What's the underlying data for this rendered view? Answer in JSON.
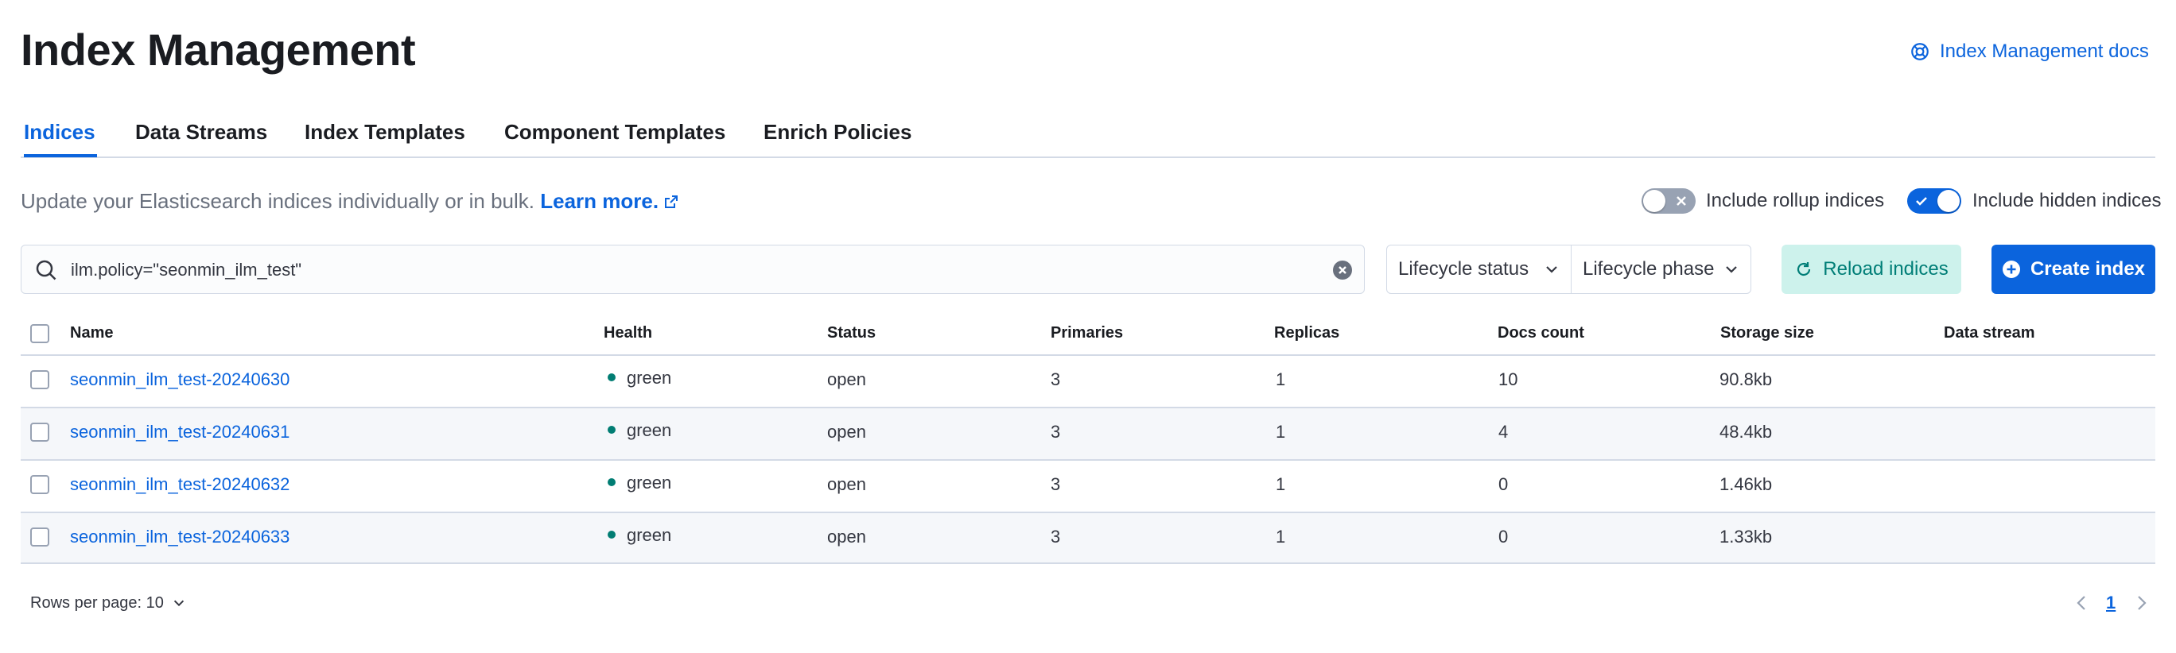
{
  "header": {
    "title": "Index Management",
    "docs_link": "Index Management docs"
  },
  "tabs": [
    {
      "label": "Indices",
      "active": true
    },
    {
      "label": "Data Streams",
      "active": false
    },
    {
      "label": "Index Templates",
      "active": false
    },
    {
      "label": "Component Templates",
      "active": false
    },
    {
      "label": "Enrich Policies",
      "active": false
    }
  ],
  "description": {
    "text": "Update your Elasticsearch indices individually or in bulk.",
    "learn_more": "Learn more."
  },
  "toggles": {
    "rollup": {
      "label": "Include rollup indices",
      "checked": false
    },
    "hidden": {
      "label": "Include hidden indices",
      "checked": true
    }
  },
  "search": {
    "value": "ilm.policy=\"seonmin_ilm_test\""
  },
  "filters": {
    "lifecycle_status": "Lifecycle status",
    "lifecycle_phase": "Lifecycle phase"
  },
  "buttons": {
    "reload": "Reload indices",
    "create": "Create index"
  },
  "table": {
    "columns": [
      "Name",
      "Health",
      "Status",
      "Primaries",
      "Replicas",
      "Docs count",
      "Storage size",
      "Data stream"
    ],
    "rows": [
      {
        "name": "seonmin_ilm_test-20240630",
        "health": "green",
        "status": "open",
        "primaries": "3",
        "replicas": "1",
        "docs_count": "10",
        "storage_size": "90.8kb",
        "data_stream": ""
      },
      {
        "name": "seonmin_ilm_test-20240631",
        "health": "green",
        "status": "open",
        "primaries": "3",
        "replicas": "1",
        "docs_count": "4",
        "storage_size": "48.4kb",
        "data_stream": ""
      },
      {
        "name": "seonmin_ilm_test-20240632",
        "health": "green",
        "status": "open",
        "primaries": "3",
        "replicas": "1",
        "docs_count": "0",
        "storage_size": "1.46kb",
        "data_stream": ""
      },
      {
        "name": "seonmin_ilm_test-20240633",
        "health": "green",
        "status": "open",
        "primaries": "3",
        "replicas": "1",
        "docs_count": "0",
        "storage_size": "1.33kb",
        "data_stream": ""
      }
    ]
  },
  "pagination": {
    "rows_per_page": "Rows per page: 10",
    "current_page": "1"
  },
  "colors": {
    "primary": "#0b64dd",
    "health_green": "#017d73",
    "reload_bg": "#cdf2ec",
    "reload_text": "#007e77"
  },
  "icons": [
    "docs-icon",
    "external-link-icon",
    "search-icon",
    "clear-icon",
    "chevron-down-icon",
    "refresh-icon",
    "plus-circle-icon",
    "chevron-left-icon",
    "chevron-right-icon"
  ]
}
